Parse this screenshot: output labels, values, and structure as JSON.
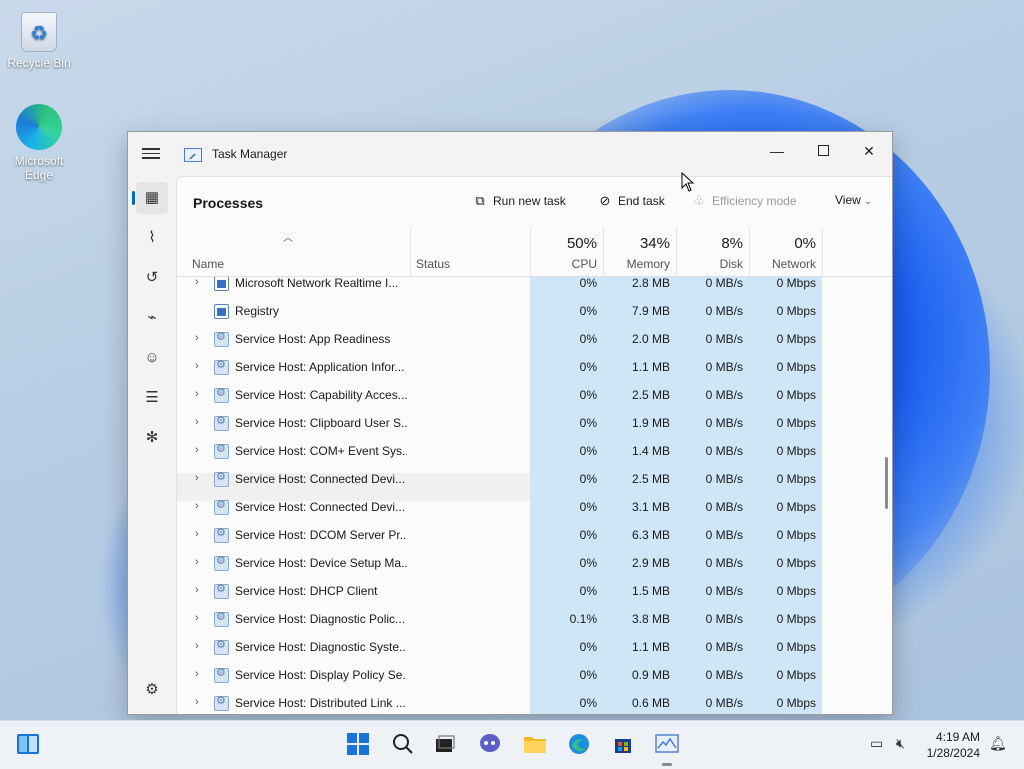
{
  "desktop": {
    "icons": [
      {
        "label": "Recycle Bin"
      },
      {
        "label": "Microsoft Edge"
      }
    ]
  },
  "window": {
    "title": "Task Manager",
    "controls": {
      "minimize": "—",
      "maximize": "",
      "close": "✕"
    }
  },
  "sidebar": {
    "items": [
      {
        "name": "processes",
        "icon": "▦"
      },
      {
        "name": "performance",
        "icon": "⌇"
      },
      {
        "name": "app-history",
        "icon": "↺"
      },
      {
        "name": "startup-apps",
        "icon": "⌁"
      },
      {
        "name": "users",
        "icon": "☺"
      },
      {
        "name": "details",
        "icon": "☰"
      },
      {
        "name": "services",
        "icon": "✻"
      }
    ],
    "settings_icon": "⚙"
  },
  "toolbar": {
    "page_title": "Processes",
    "run_new_task": "Run new task",
    "end_task": "End task",
    "efficiency_mode": "Efficiency mode",
    "view": "View"
  },
  "columns": {
    "name": "Name",
    "status": "Status",
    "cpu_pct": "50%",
    "cpu": "CPU",
    "memory_pct": "34%",
    "memory": "Memory",
    "disk_pct": "8%",
    "disk": "Disk",
    "network_pct": "0%",
    "network": "Network"
  },
  "processes": [
    {
      "name": "Microsoft Network Realtime I...",
      "icon": "win",
      "expand": true,
      "cpu": "0%",
      "memory": "2.8 MB",
      "disk": "0 MB/s",
      "network": "0 Mbps"
    },
    {
      "name": "Registry",
      "icon": "win",
      "expand": false,
      "cpu": "0%",
      "memory": "7.9 MB",
      "disk": "0 MB/s",
      "network": "0 Mbps"
    },
    {
      "name": "Service Host: App Readiness",
      "icon": "gear",
      "expand": true,
      "cpu": "0%",
      "memory": "2.0 MB",
      "disk": "0 MB/s",
      "network": "0 Mbps"
    },
    {
      "name": "Service Host: Application Infor...",
      "icon": "gear",
      "expand": true,
      "cpu": "0%",
      "memory": "1.1 MB",
      "disk": "0 MB/s",
      "network": "0 Mbps"
    },
    {
      "name": "Service Host: Capability Acces...",
      "icon": "gear",
      "expand": true,
      "cpu": "0%",
      "memory": "2.5 MB",
      "disk": "0 MB/s",
      "network": "0 Mbps"
    },
    {
      "name": "Service Host: Clipboard User S...",
      "icon": "gear",
      "expand": true,
      "cpu": "0%",
      "memory": "1.9 MB",
      "disk": "0 MB/s",
      "network": "0 Mbps"
    },
    {
      "name": "Service Host: COM+ Event Sys...",
      "icon": "gear",
      "expand": true,
      "cpu": "0%",
      "memory": "1.4 MB",
      "disk": "0 MB/s",
      "network": "0 Mbps"
    },
    {
      "name": "Service Host: Connected Devi...",
      "icon": "gear",
      "expand": true,
      "cpu": "0%",
      "memory": "2.5 MB",
      "disk": "0 MB/s",
      "network": "0 Mbps",
      "hover": true
    },
    {
      "name": "Service Host: Connected Devi...",
      "icon": "gear",
      "expand": true,
      "cpu": "0%",
      "memory": "3.1 MB",
      "disk": "0 MB/s",
      "network": "0 Mbps"
    },
    {
      "name": "Service Host: DCOM Server Pr...",
      "icon": "gear",
      "expand": true,
      "cpu": "0%",
      "memory": "6.3 MB",
      "disk": "0 MB/s",
      "network": "0 Mbps"
    },
    {
      "name": "Service Host: Device Setup Ma...",
      "icon": "gear",
      "expand": true,
      "cpu": "0%",
      "memory": "2.9 MB",
      "disk": "0 MB/s",
      "network": "0 Mbps"
    },
    {
      "name": "Service Host: DHCP Client",
      "icon": "gear",
      "expand": true,
      "cpu": "0%",
      "memory": "1.5 MB",
      "disk": "0 MB/s",
      "network": "0 Mbps"
    },
    {
      "name": "Service Host: Diagnostic Polic...",
      "icon": "gear",
      "expand": true,
      "cpu": "0.1%",
      "memory": "3.8 MB",
      "disk": "0 MB/s",
      "network": "0 Mbps"
    },
    {
      "name": "Service Host: Diagnostic Syste...",
      "icon": "gear",
      "expand": true,
      "cpu": "0%",
      "memory": "1.1 MB",
      "disk": "0 MB/s",
      "network": "0 Mbps"
    },
    {
      "name": "Service Host: Display Policy Se...",
      "icon": "gear",
      "expand": true,
      "cpu": "0%",
      "memory": "0.9 MB",
      "disk": "0 MB/s",
      "network": "0 Mbps"
    },
    {
      "name": "Service Host: Distributed Link ...",
      "icon": "gear",
      "expand": true,
      "cpu": "0%",
      "memory": "0.6 MB",
      "disk": "0 MB/s",
      "network": "0 Mbps"
    }
  ],
  "taskbar": {
    "apps": [
      "widgets-icon",
      "start-icon",
      "search-icon",
      "task-view-icon",
      "chat-icon",
      "file-explorer-icon",
      "edge-icon",
      "store-icon",
      "task-manager-icon"
    ],
    "time": "4:19 AM",
    "date": "1/28/2024"
  }
}
